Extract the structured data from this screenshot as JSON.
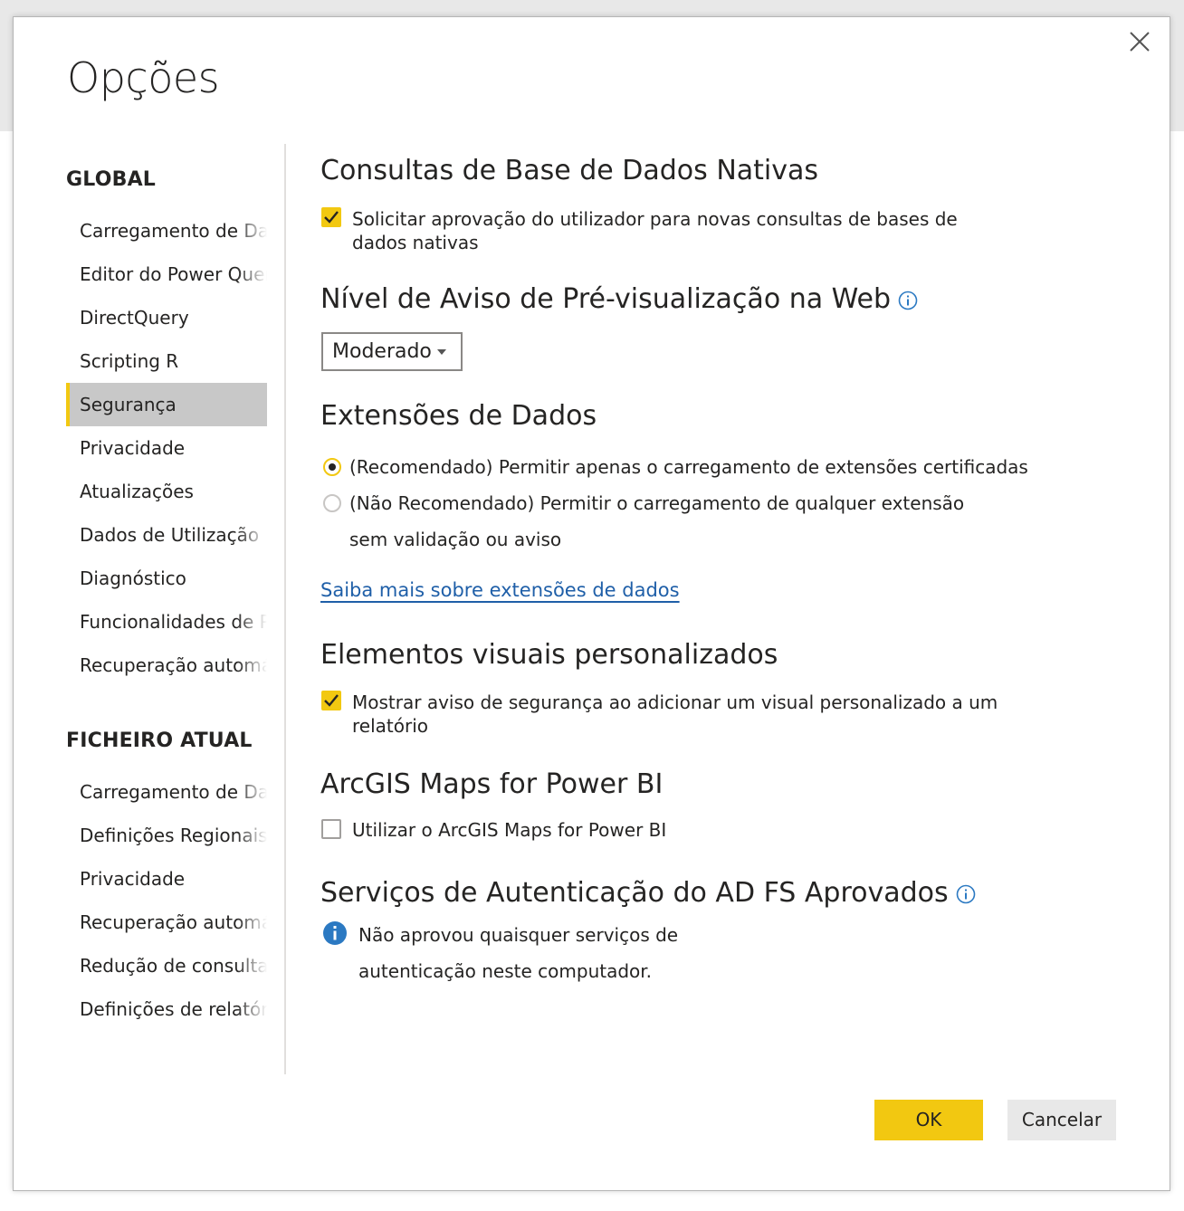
{
  "dialog": {
    "title": "Opções",
    "close_label": "Fechar"
  },
  "nav": {
    "global_heading": "GLOBAL",
    "global_items": [
      "Carregamento de Dados",
      "Editor do Power Query",
      "DirectQuery",
      "Scripting R",
      "Segurança",
      "Privacidade",
      "Atualizações",
      "Dados de Utilização",
      "Diagnóstico",
      "Funcionalidades de Pré-visualização",
      "Recuperação automática"
    ],
    "selected_item": "Segurança",
    "current_heading": "FICHEIRO ATUAL",
    "current_items": [
      "Carregamento de Dados",
      "Definições Regionais",
      "Privacidade",
      "Recuperação automática",
      "Redução de consultas",
      "Definições de relatório"
    ]
  },
  "native_queries": {
    "title": "Consultas de Base de Dados Nativas",
    "checkbox_line1": "Solicitar aprovação do utilizador para novas consultas de bases de",
    "checkbox_line2": "dados nativas",
    "checked": true
  },
  "web_preview": {
    "title": "Nível de Aviso de Pré-visualização na Web",
    "dropdown_value": "Moderado"
  },
  "data_extensions": {
    "title": "Extensões de Dados",
    "option_recommended": "(Recomendado) Permitir apenas o carregamento de extensões certificadas",
    "option_not_recommended_line1": "(Não Recomendado) Permitir o carregamento de qualquer extensão",
    "option_not_recommended_line2": "sem validação ou aviso",
    "selected": "recommended",
    "learn_more_link": "Saiba mais sobre extensões de dados"
  },
  "custom_visuals": {
    "title": "Elementos visuais personalizados",
    "checkbox_line1": "Mostrar aviso de segurança ao adicionar um visual personalizado a um",
    "checkbox_line2": "relatório",
    "checked": true
  },
  "arcgis": {
    "title": "ArcGIS Maps for Power BI",
    "checkbox_label": "Utilizar o ArcGIS Maps for Power BI",
    "checked": false
  },
  "adfs": {
    "title": "Serviços de Autenticação do AD FS Aprovados",
    "message_line1": "Não aprovou quaisquer serviços de",
    "message_line2": "autenticação neste computador."
  },
  "buttons": {
    "ok": "OK",
    "cancel": "Cancelar"
  },
  "colors": {
    "accent": "#f2c811",
    "link": "#1f5fa8",
    "info": "#2b79c2",
    "selected_nav_bg": "#c8c8c8"
  }
}
